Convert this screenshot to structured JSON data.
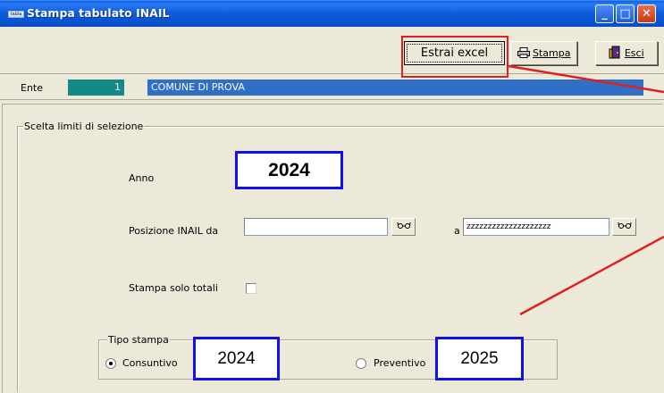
{
  "window": {
    "title": "Stampa tabulato INAIL",
    "icon_text": "tabla",
    "controls": {
      "minimize": "_",
      "maximize": "□",
      "close": "✕"
    }
  },
  "toolbar": {
    "extract_excel_label": "Estrai excel",
    "print_label": "Stampa",
    "exit_label": "Esci",
    "print_icon": "printer-icon",
    "exit_icon": "door-exit-icon"
  },
  "ente": {
    "label": "Ente",
    "code": "1",
    "name": "COMUNE DI PROVA"
  },
  "selection": {
    "group_title": "Scelta limiti di selezione",
    "year_label": "Anno",
    "year_value": "2024",
    "position_from_label": "Posizione INAIL da",
    "position_from_value": "",
    "position_to_label": "a",
    "position_to_value": "zzzzzzzzzzzzzzzzzzzz",
    "lookup_icon": "glasses-icon",
    "only_totals_label": "Stampa solo totali",
    "only_totals_checked": false
  },
  "print_type": {
    "group_title": "Tipo stampa",
    "option_final_label": "Consuntivo",
    "option_final_selected": true,
    "option_final_year": "2024",
    "option_estimate_label": "Preventivo",
    "option_estimate_selected": false,
    "option_estimate_year": "2025"
  },
  "colors": {
    "annotation_red": "#E02020",
    "annotation_blue": "#1010F0",
    "ente_code_bg": "#148A88",
    "ente_name_bg": "#2F6FC6"
  }
}
